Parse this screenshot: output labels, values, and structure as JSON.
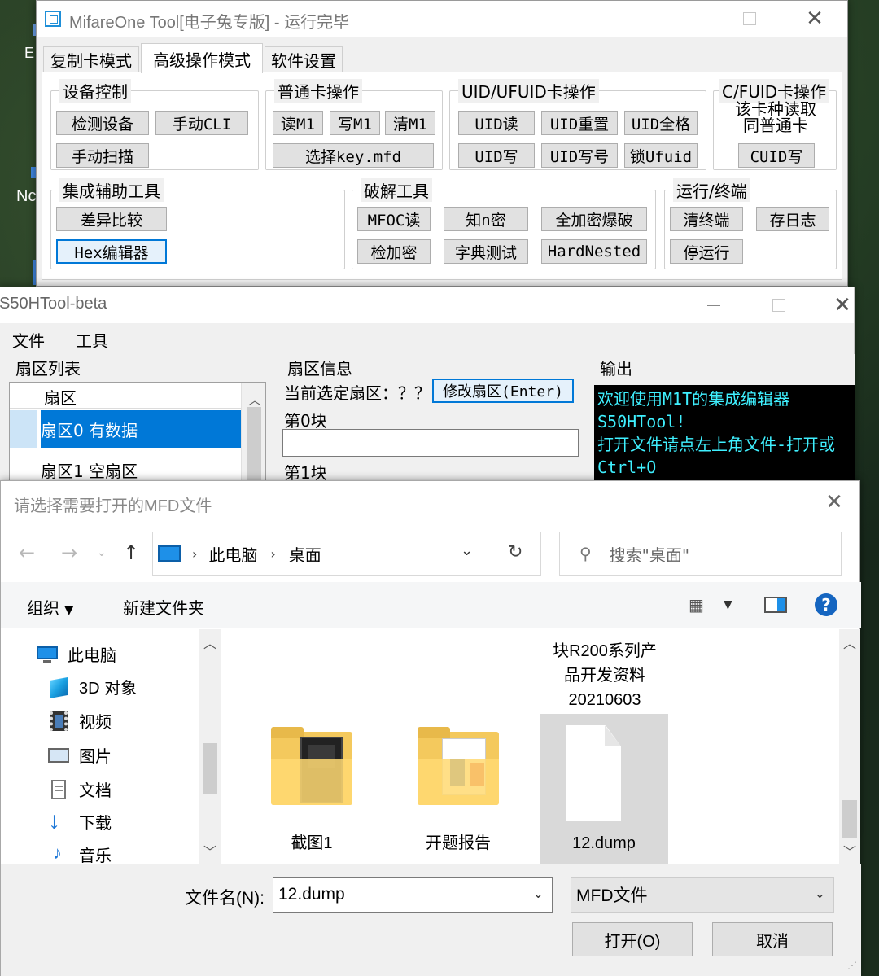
{
  "colors": {
    "accent": "#0078d7",
    "output_bg": "#000000",
    "output_text": "#3ff0ff",
    "help_blue": "#1565c0"
  },
  "desktop": {
    "text1": "Nc",
    "text2": "E"
  },
  "mifare": {
    "title": "MifareOne Tool[电子兔专版] - 运行完毕",
    "tabs": [
      "复制卡模式",
      "高级操作模式",
      "软件设置"
    ],
    "active_tab": "高级操作模式",
    "groups": {
      "device": {
        "label": "设备控制",
        "buttons": [
          "检测设备",
          "手动CLI",
          "手动扫描"
        ]
      },
      "normal": {
        "label": "普通卡操作",
        "buttons": [
          "读M1",
          "写M1",
          "清M1",
          "选择key.mfd"
        ]
      },
      "uid": {
        "label": "UID/UFUID卡操作",
        "buttons": [
          "UID读",
          "UID重置",
          "UID全格",
          "UID写",
          "UID写号",
          "锁Ufuid"
        ]
      },
      "cfuid": {
        "label": "C/FUID卡操作",
        "note_line1": "该卡种读取",
        "note_line2": "同普通卡",
        "buttons": [
          "CUID写"
        ]
      },
      "helper": {
        "label": "集成辅助工具",
        "buttons": [
          "差异比较",
          "Hex编辑器"
        ]
      },
      "crack": {
        "label": "破解工具",
        "buttons": [
          "MFOC读",
          "知n密",
          "全加密爆破",
          "检加密",
          "字典测试",
          "HardNested"
        ]
      },
      "run": {
        "label": "运行/终端",
        "buttons": [
          "清终端",
          "存日志",
          "停运行"
        ]
      }
    }
  },
  "s50": {
    "title": "S50HTool-beta",
    "menu": [
      "文件",
      "工具"
    ],
    "sector_list": {
      "title": "扇区列表",
      "header": "扇区",
      "rows": [
        "扇区0 有数据",
        "扇区1 空扇区"
      ],
      "selected_index": 0
    },
    "sector_info": {
      "title": "扇区信息",
      "current_label": "当前选定扇区：？？",
      "edit_button": "修改扇区(Enter)",
      "block0": "第0块",
      "block1": "第1块"
    },
    "output": {
      "title": "输出",
      "lines": [
        "欢迎使用M1T的集成编辑器",
        "S50HTool!",
        "打开文件请点左上角文件-打开或",
        "Ctrl+O"
      ]
    }
  },
  "dialog": {
    "title": "请选择需要打开的MFD文件",
    "breadcrumb": [
      "此电脑",
      "桌面"
    ],
    "search_placeholder": "搜索\"桌面\"",
    "toolbar": {
      "organize": "组织",
      "new_folder": "新建文件夹"
    },
    "nav": [
      {
        "label": "此电脑",
        "icon": "computer-icon"
      },
      {
        "label": "3D 对象",
        "icon": "cube-icon"
      },
      {
        "label": "视频",
        "icon": "video-icon"
      },
      {
        "label": "图片",
        "icon": "picture-icon"
      },
      {
        "label": "文档",
        "icon": "document-icon"
      },
      {
        "label": "下载",
        "icon": "download-icon"
      },
      {
        "label": "音乐",
        "icon": "music-icon"
      }
    ],
    "files_partial": [
      "块R200系列产",
      "品开发资料",
      "20210603"
    ],
    "files": [
      {
        "name": "截图1",
        "icon": "folder-icon"
      },
      {
        "name": "开题报告",
        "icon": "folder-icon"
      },
      {
        "name": "12.dump",
        "icon": "file-icon",
        "selected": true
      }
    ],
    "filename_label": "文件名(N):",
    "filename_value": "12.dump",
    "filter_value": "MFD文件",
    "open_button": "打开(O)",
    "cancel_button": "取消"
  }
}
